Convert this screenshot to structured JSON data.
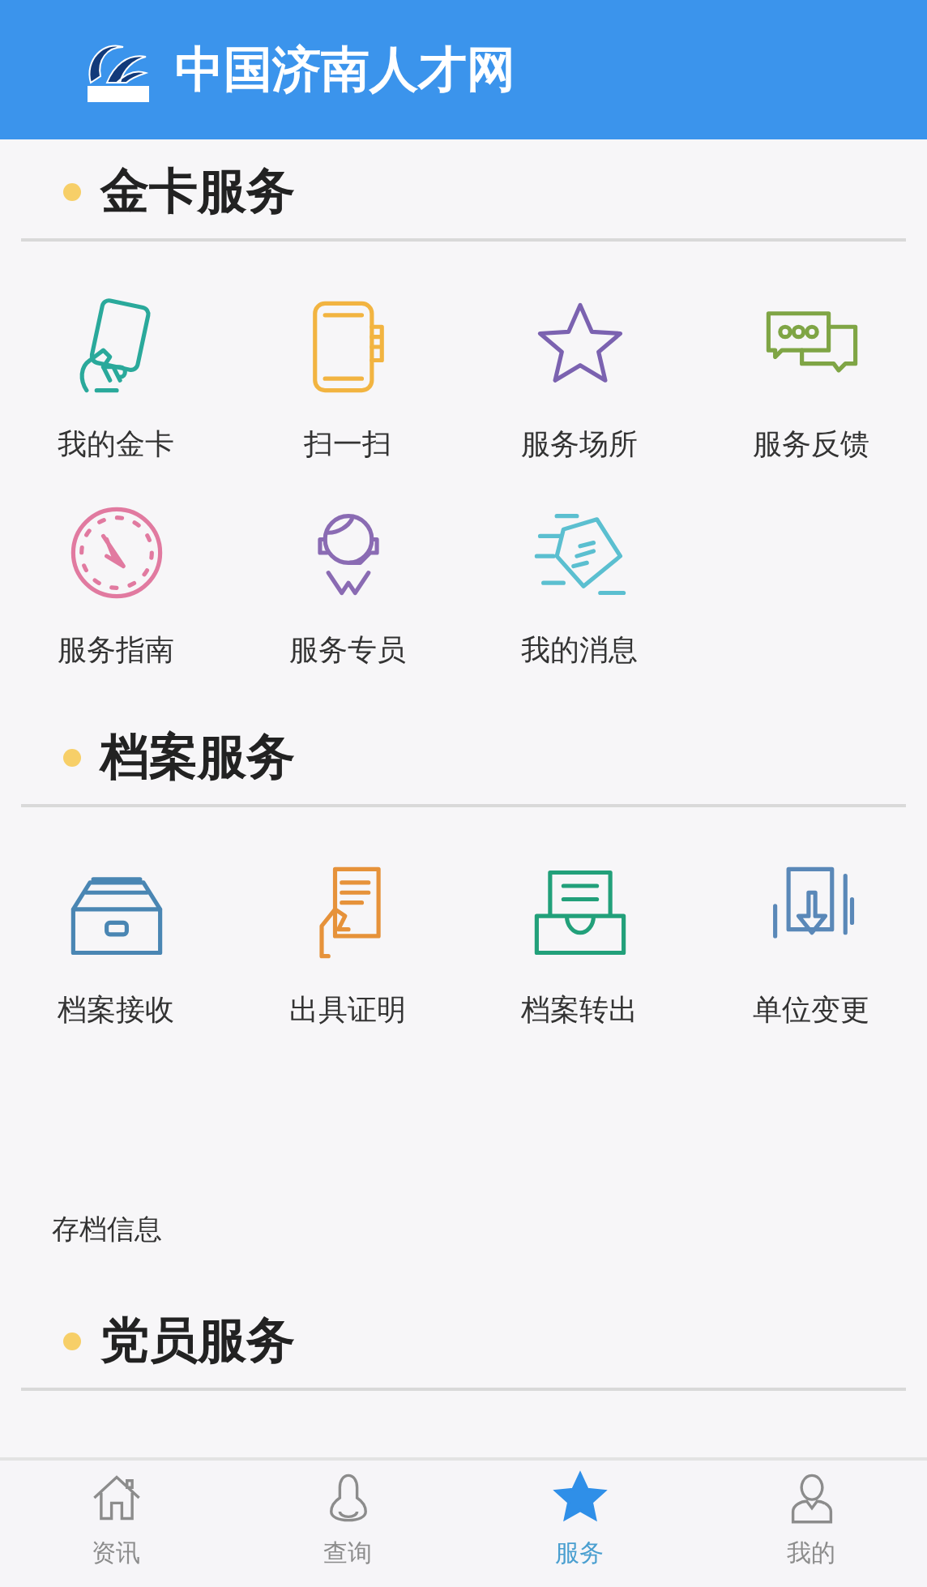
{
  "header": {
    "title": "中国济南人才网"
  },
  "sections": [
    {
      "title": "金卡服务",
      "items": [
        {
          "kind": "card",
          "label": "我的金卡"
        },
        {
          "kind": "scan",
          "label": "扫一扫"
        },
        {
          "kind": "star",
          "label": "服务场所"
        },
        {
          "kind": "chat",
          "label": "服务反馈"
        },
        {
          "kind": "compass",
          "label": "服务指南"
        },
        {
          "kind": "agent",
          "label": "服务专员"
        },
        {
          "kind": "message",
          "label": "我的消息"
        }
      ]
    },
    {
      "title": "档案服务",
      "items": [
        {
          "kind": "drawer",
          "label": "档案接收"
        },
        {
          "kind": "certificate",
          "label": "出具证明"
        },
        {
          "kind": "tray",
          "label": "档案转出"
        },
        {
          "kind": "transfer",
          "label": "单位变更"
        }
      ],
      "note": "存档信息"
    },
    {
      "title": "党员服务"
    }
  ],
  "tabbar": [
    {
      "kind": "home",
      "label": "资讯",
      "selected": false
    },
    {
      "kind": "bell",
      "label": "查询",
      "selected": false
    },
    {
      "kind": "star",
      "label": "服务",
      "selected": true
    },
    {
      "kind": "person",
      "label": "我的",
      "selected": false
    }
  ]
}
